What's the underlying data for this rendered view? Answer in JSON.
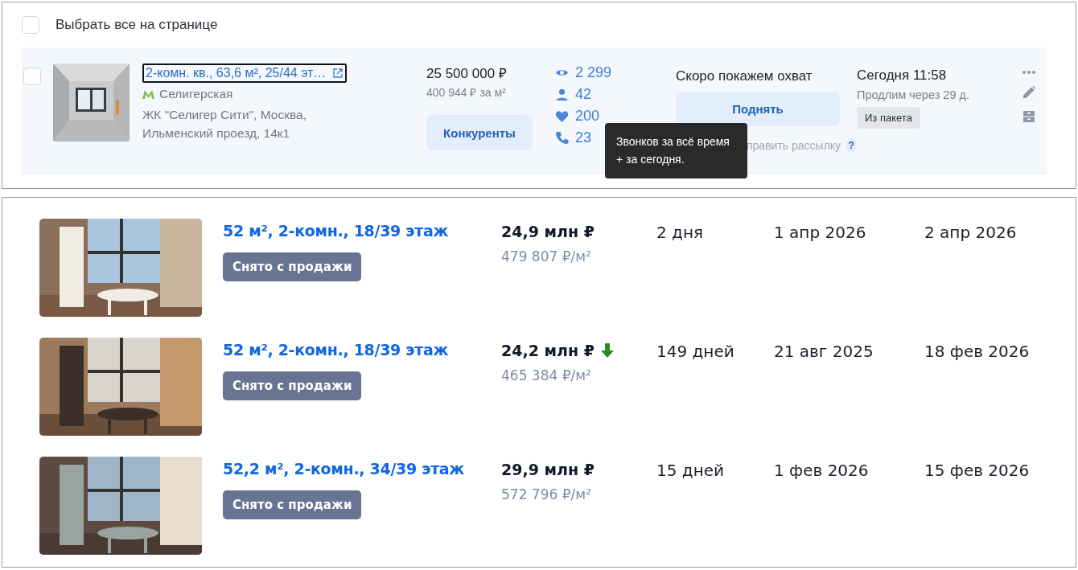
{
  "select_all": {
    "label": "Выбрать все на странице",
    "checked": false
  },
  "listing": {
    "checked": false,
    "title": "2-комн. кв., 63,6 м², 25/44 эт…",
    "focused": true,
    "metro": "Селигерская",
    "address": "ЖК \"Селигер Сити\", Москва, Ильменский проезд, 14к1",
    "price": "25 500 000 ₽",
    "price_per_m2": "400 944 ₽ за м²",
    "competitors_button": "Конкуренты",
    "stats": [
      {
        "kind": "views",
        "value": "2 299"
      },
      {
        "kind": "contacts",
        "value": "42"
      },
      {
        "kind": "favorites",
        "value": "200"
      },
      {
        "kind": "calls",
        "value": "23"
      }
    ],
    "reach_note": "Скоро покажем охват",
    "raise_button": "Поднять",
    "mailing_link": "править рассылку",
    "help": "?",
    "date": "Сегодня 11:58",
    "renew_note": "Продлим через 29 д.",
    "package_tag": "Из пакета",
    "tooltip": "Звонков за всё время + за сегодня."
  },
  "history": [
    {
      "title": "52 м², 2-комн., 18/39 этаж",
      "status": "Снято с продажи",
      "price": "24,9 млн ₽",
      "price_drop": false,
      "price_per_m2": "479 807 ₽/м²",
      "days": "2 дня",
      "date_start": "1 апр 2026",
      "date_end": "2 апр 2026"
    },
    {
      "title": "52 м², 2-комн., 18/39 этаж",
      "status": "Снято с продажи",
      "price": "24,2 млн ₽",
      "price_drop": true,
      "price_per_m2": "465 384 ₽/м²",
      "days": "149 дней",
      "date_start": "21 авг 2025",
      "date_end": "18 фев 2026"
    },
    {
      "title": "52,2 м², 2-комн., 34/39 этаж",
      "status": "Снято с продажи",
      "price": "29,9 млн ₽",
      "price_drop": false,
      "price_per_m2": "572 796 ₽/м²",
      "days": "15 дней",
      "date_start": "1 фев 2026",
      "date_end": "15 фев 2026"
    }
  ]
}
